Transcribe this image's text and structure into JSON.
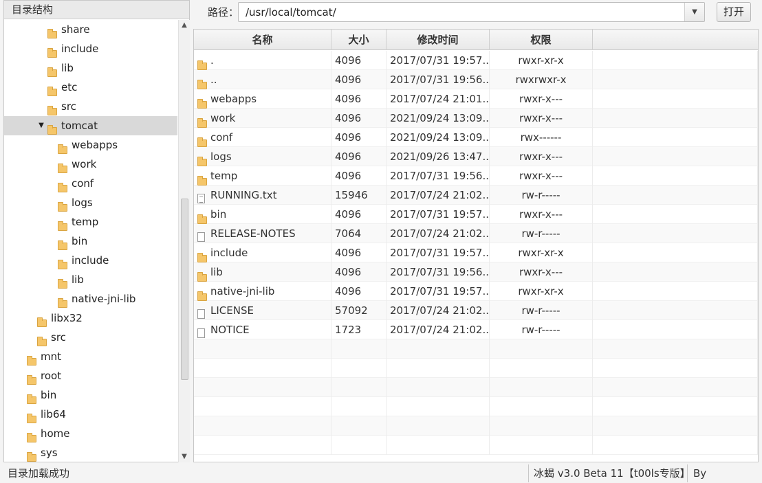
{
  "tree": {
    "header": "目录结构",
    "items": [
      {
        "label": "share",
        "depth": 3,
        "arrow": "",
        "selected": false
      },
      {
        "label": "include",
        "depth": 3,
        "arrow": "",
        "selected": false
      },
      {
        "label": "lib",
        "depth": 3,
        "arrow": "",
        "selected": false
      },
      {
        "label": "etc",
        "depth": 3,
        "arrow": "",
        "selected": false
      },
      {
        "label": "src",
        "depth": 3,
        "arrow": "",
        "selected": false
      },
      {
        "label": "tomcat",
        "depth": 3,
        "arrow": "▼",
        "selected": true
      },
      {
        "label": "webapps",
        "depth": 4,
        "arrow": "",
        "selected": false
      },
      {
        "label": "work",
        "depth": 4,
        "arrow": "",
        "selected": false
      },
      {
        "label": "conf",
        "depth": 4,
        "arrow": "",
        "selected": false
      },
      {
        "label": "logs",
        "depth": 4,
        "arrow": "",
        "selected": false
      },
      {
        "label": "temp",
        "depth": 4,
        "arrow": "",
        "selected": false
      },
      {
        "label": "bin",
        "depth": 4,
        "arrow": "",
        "selected": false
      },
      {
        "label": "include",
        "depth": 4,
        "arrow": "",
        "selected": false
      },
      {
        "label": "lib",
        "depth": 4,
        "arrow": "",
        "selected": false
      },
      {
        "label": "native-jni-lib",
        "depth": 4,
        "arrow": "",
        "selected": false
      },
      {
        "label": "libx32",
        "depth": 2,
        "arrow": "",
        "selected": false
      },
      {
        "label": "src",
        "depth": 2,
        "arrow": "",
        "selected": false
      },
      {
        "label": "mnt",
        "depth": 1,
        "arrow": "",
        "selected": false
      },
      {
        "label": "root",
        "depth": 1,
        "arrow": "",
        "selected": false
      },
      {
        "label": "bin",
        "depth": 1,
        "arrow": "",
        "selected": false
      },
      {
        "label": "lib64",
        "depth": 1,
        "arrow": "",
        "selected": false
      },
      {
        "label": "home",
        "depth": 1,
        "arrow": "",
        "selected": false
      },
      {
        "label": "sys",
        "depth": 1,
        "arrow": "",
        "selected": false
      }
    ],
    "scroll_up_icon": "▲",
    "scroll_down_icon": "▼"
  },
  "pathbar": {
    "label": "路径：",
    "value": "/usr/local/tomcat/",
    "dropdown_icon": "▼",
    "open_label": "打开"
  },
  "table": {
    "columns": {
      "name": "名称",
      "size": "大小",
      "time": "修改时间",
      "perm": "权限"
    },
    "rows": [
      {
        "name": ".",
        "type": "folder",
        "size": "4096",
        "time": "2017/07/31 19:57...",
        "perm": "rwxr-xr-x"
      },
      {
        "name": "..",
        "type": "folder",
        "size": "4096",
        "time": "2017/07/31 19:56...",
        "perm": "rwxrwxr-x"
      },
      {
        "name": "webapps",
        "type": "folder",
        "size": "4096",
        "time": "2017/07/24 21:01...",
        "perm": "rwxr-x---"
      },
      {
        "name": "work",
        "type": "folder",
        "size": "4096",
        "time": "2021/09/24 13:09...",
        "perm": "rwxr-x---"
      },
      {
        "name": "conf",
        "type": "folder",
        "size": "4096",
        "time": "2021/09/24 13:09...",
        "perm": "rwx------"
      },
      {
        "name": "logs",
        "type": "folder",
        "size": "4096",
        "time": "2021/09/26 13:47...",
        "perm": "rwxr-x---"
      },
      {
        "name": "temp",
        "type": "folder",
        "size": "4096",
        "time": "2017/07/31 19:56...",
        "perm": "rwxr-x---"
      },
      {
        "name": "RUNNING.txt",
        "type": "textfile",
        "size": "15946",
        "time": "2017/07/24 21:02...",
        "perm": "rw-r-----"
      },
      {
        "name": "bin",
        "type": "folder",
        "size": "4096",
        "time": "2017/07/31 19:57...",
        "perm": "rwxr-x---"
      },
      {
        "name": "RELEASE-NOTES",
        "type": "file",
        "size": "7064",
        "time": "2017/07/24 21:02...",
        "perm": "rw-r-----"
      },
      {
        "name": "include",
        "type": "folder",
        "size": "4096",
        "time": "2017/07/31 19:57...",
        "perm": "rwxr-xr-x"
      },
      {
        "name": "lib",
        "type": "folder",
        "size": "4096",
        "time": "2017/07/31 19:56...",
        "perm": "rwxr-x---"
      },
      {
        "name": "native-jni-lib",
        "type": "folder",
        "size": "4096",
        "time": "2017/07/31 19:57...",
        "perm": "rwxr-xr-x"
      },
      {
        "name": "LICENSE",
        "type": "file",
        "size": "57092",
        "time": "2017/07/24 21:02...",
        "perm": "rw-r-----"
      },
      {
        "name": "NOTICE",
        "type": "file",
        "size": "1723",
        "time": "2017/07/24 21:02...",
        "perm": "rw-r-----"
      }
    ]
  },
  "status": {
    "message": "目录加载成功",
    "version": "冰蝎 v3.0 Beta 11【t00ls专版】",
    "author": "By rebeyond"
  },
  "icons": {
    "folder": "folder-icon",
    "file": "file-icon",
    "textfile": "text-file-icon"
  }
}
